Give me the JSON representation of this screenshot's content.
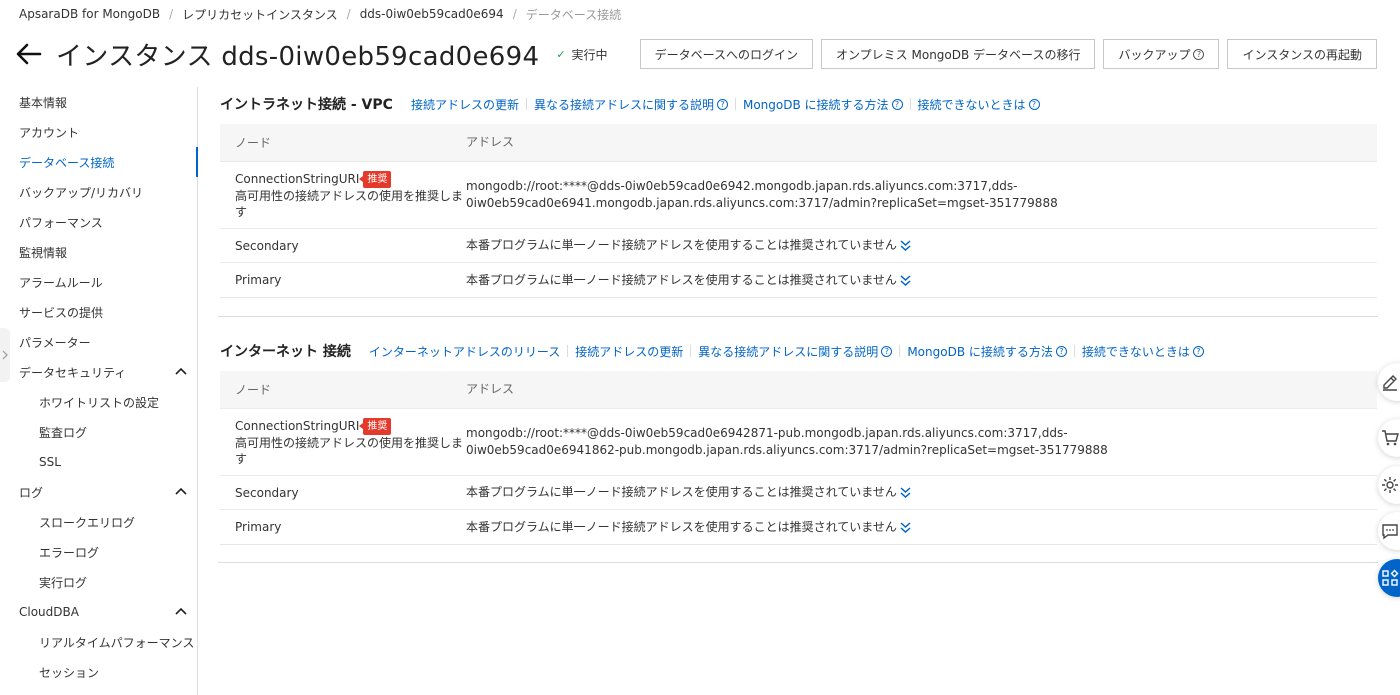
{
  "breadcrumb": [
    "ApsaraDB for MongoDB",
    "レプリカセットインスタンス",
    "dds-0iw0eb59cad0e694",
    "データベース接続"
  ],
  "page": {
    "title": "インスタンス dds-0iw0eb59cad0e694",
    "status": "実行中"
  },
  "actions": {
    "login": "データベースへのログイン",
    "migrate": "オンプレミス MongoDB データベースの移行",
    "backup": "バックアップ",
    "restart": "インスタンスの再起動"
  },
  "sidebar": {
    "items": [
      {
        "label": "基本情報"
      },
      {
        "label": "アカウント"
      },
      {
        "label": "データベース接続"
      },
      {
        "label": "バックアップ/リカバリ"
      },
      {
        "label": "パフォーマンス"
      },
      {
        "label": "監視情報"
      },
      {
        "label": "アラームルール"
      },
      {
        "label": "サービスの提供"
      },
      {
        "label": "パラメーター"
      },
      {
        "label": "データセキュリティ"
      },
      {
        "label": "ホワイトリストの設定"
      },
      {
        "label": "監査ログ"
      },
      {
        "label": "SSL"
      },
      {
        "label": "ログ"
      },
      {
        "label": "スロークエリログ"
      },
      {
        "label": "エラーログ"
      },
      {
        "label": "実行ログ"
      },
      {
        "label": "CloudDBA"
      },
      {
        "label": "リアルタイムパフォーマンス"
      },
      {
        "label": "セッション"
      }
    ]
  },
  "vpc": {
    "title": "イントラネット接続 - VPC",
    "links": {
      "update": "接続アドレスの更新",
      "explain": "異なる接続アドレスに関する説明",
      "howto": "MongoDB に接続する方法",
      "trouble": "接続できないときは"
    },
    "headers": {
      "node": "ノード",
      "address": "アドレス"
    },
    "rows": [
      {
        "node": "ConnectionStringURI",
        "badge": "推奨",
        "desc": "高可用性の接続アドレスの使用を推奨します",
        "address": "mongodb://root:****@dds-0iw0eb59cad0e6942.mongodb.japan.rds.aliyuncs.com:3717,dds-0iw0eb59cad0e6941.mongodb.japan.rds.aliyuncs.com:3717/admin?replicaSet=mgset-351779888"
      },
      {
        "node": "Secondary",
        "address": "本番プログラムに単一ノード接続アドレスを使用することは推奨されていません"
      },
      {
        "node": "Primary",
        "address": "本番プログラムに単一ノード接続アドレスを使用することは推奨されていません"
      }
    ]
  },
  "internet": {
    "title": "インターネット 接続",
    "links": {
      "release": "インターネットアドレスのリリース",
      "update": "接続アドレスの更新",
      "explain": "異なる接続アドレスに関する説明",
      "howto": "MongoDB に接続する方法",
      "trouble": "接続できないときは"
    },
    "headers": {
      "node": "ノード",
      "address": "アドレス"
    },
    "rows": [
      {
        "node": "ConnectionStringURI",
        "badge": "推奨",
        "desc": "高可用性の接続アドレスの使用を推奨します",
        "address": "mongodb://root:****@dds-0iw0eb59cad0e6942871-pub.mongodb.japan.rds.aliyuncs.com:3717,dds-0iw0eb59cad0e6941862-pub.mongodb.japan.rds.aliyuncs.com:3717/admin?replicaSet=mgset-351779888"
      },
      {
        "node": "Secondary",
        "address": "本番プログラムに単一ノード接続アドレスを使用することは推奨されていません"
      },
      {
        "node": "Primary",
        "address": "本番プログラムに単一ノード接続アドレスを使用することは推奨されていません"
      }
    ]
  },
  "icons": [
    "back-arrow-icon",
    "check-icon",
    "help-icon",
    "chevron-up-icon",
    "double-chevron-down-icon",
    "edit-icon",
    "cart-icon",
    "gear-icon",
    "chat-icon",
    "apps-icon"
  ],
  "colors": {
    "accent": "#0064c8",
    "badge": "#e33a2b",
    "running": "#1e9c4a"
  }
}
